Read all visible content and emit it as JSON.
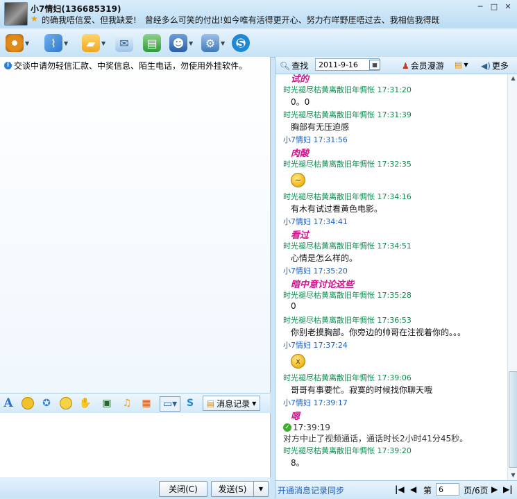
{
  "window": {
    "contact_name": "小7情妇(136685319)",
    "signature": "的确我唔信爱、但我缺爱!　曾经多么可笑的付出!如今唯有活得更开心、努力冇咩野厓唔过去、我相信我得既"
  },
  "toolbar": {
    "items": [
      {
        "name": "video-call",
        "icon": "webcam-icon",
        "color": "#e08a1c"
      },
      {
        "name": "voice-call",
        "icon": "microphone-icon",
        "color": "#2f77c9"
      },
      {
        "name": "send-file",
        "icon": "folder-icon",
        "color": "#f0a720"
      },
      {
        "name": "send-mail",
        "icon": "mail-icon",
        "color": "#7fb0d8"
      },
      {
        "name": "send-sms",
        "icon": "sms-icon",
        "color": "#2e9a3a"
      },
      {
        "name": "create-discussion",
        "icon": "group-icon",
        "color": "#2a5fa8"
      },
      {
        "name": "app-settings",
        "icon": "settings-icon",
        "color": "#3f79b8"
      },
      {
        "name": "soso",
        "icon": "soso-icon",
        "color": "#1e88d4"
      }
    ]
  },
  "left": {
    "notice": "交谈中请勿轻信汇款、中奖信息、陌生电话，勿使用外挂软件。",
    "message_record_label": "消息记录",
    "close_label": "关闭(C)",
    "send_label": "发送(S)"
  },
  "history": {
    "search_label": "查找",
    "date_value": "2011-9-16",
    "member_roam_label": "会员漫游",
    "more_label": "更多",
    "sync_link": "开通消息记录同步",
    "page_prefix": "第",
    "page_value": "6",
    "page_suffix": "页/6页",
    "messages": [
      {
        "type": "body-magenta",
        "text": "试的"
      },
      {
        "type": "hdr-other",
        "text": "时光褪尽枯黄离散旧年惆怅  17:31:20"
      },
      {
        "type": "body-txt",
        "text": "0。0"
      },
      {
        "type": "hdr-other",
        "text": "时光褪尽枯黄离散旧年惆怅  17:31:39"
      },
      {
        "type": "body-txt",
        "text": "胸部有无压迫感"
      },
      {
        "type": "hdr-self",
        "text": "小7情妇  17:31:56"
      },
      {
        "type": "body-magenta",
        "text": "肉酸"
      },
      {
        "type": "hdr-other",
        "text": "时光褪尽枯黄离散旧年惆怅  17:32:35"
      },
      {
        "type": "emoji",
        "text": "~"
      },
      {
        "type": "hdr-other",
        "text": "时光褪尽枯黄离散旧年惆怅  17:34:16"
      },
      {
        "type": "body-txt",
        "text": "有木有试过看黄色电影。"
      },
      {
        "type": "hdr-self",
        "text": "小7情妇  17:34:41"
      },
      {
        "type": "body-magenta",
        "text": "看过"
      },
      {
        "type": "hdr-other",
        "text": "时光褪尽枯黄离散旧年惆怅  17:34:51"
      },
      {
        "type": "body-txt",
        "text": "心情是怎么样的。"
      },
      {
        "type": "hdr-self",
        "text": "小7情妇  17:35:20"
      },
      {
        "type": "body-magenta",
        "text": "暗中意讨论这些"
      },
      {
        "type": "hdr-other",
        "text": "时光褪尽枯黄离散旧年惆怅  17:35:28"
      },
      {
        "type": "body-txt",
        "text": "0"
      },
      {
        "type": "hdr-other",
        "text": "时光褪尽枯黄离散旧年惆怅  17:36:53"
      },
      {
        "type": "body-txt",
        "text": "你别老摸胸部。你旁边的帅哥在注视着你的。。。"
      },
      {
        "type": "hdr-self",
        "text": "小7情妇  17:37:24"
      },
      {
        "type": "emoji",
        "text": "x"
      },
      {
        "type": "hdr-other",
        "text": "时光褪尽枯黄离散旧年惆怅  17:39:06"
      },
      {
        "type": "body-txt",
        "text": "哥哥有事要忙。寂寞的时候找你聊天哦"
      },
      {
        "type": "hdr-self",
        "text": "小7情妇  17:39:17"
      },
      {
        "type": "body-magenta",
        "text": "嗯"
      },
      {
        "type": "sys-time",
        "text": "17:39:19"
      },
      {
        "type": "sys-txt",
        "text": "对方中止了视频通话，通话时长2小时41分45秒。"
      },
      {
        "type": "hdr-other",
        "text": "时光褪尽枯黄离散旧年惆怅  17:39:20"
      },
      {
        "type": "body-txt",
        "text": "8。"
      }
    ]
  }
}
